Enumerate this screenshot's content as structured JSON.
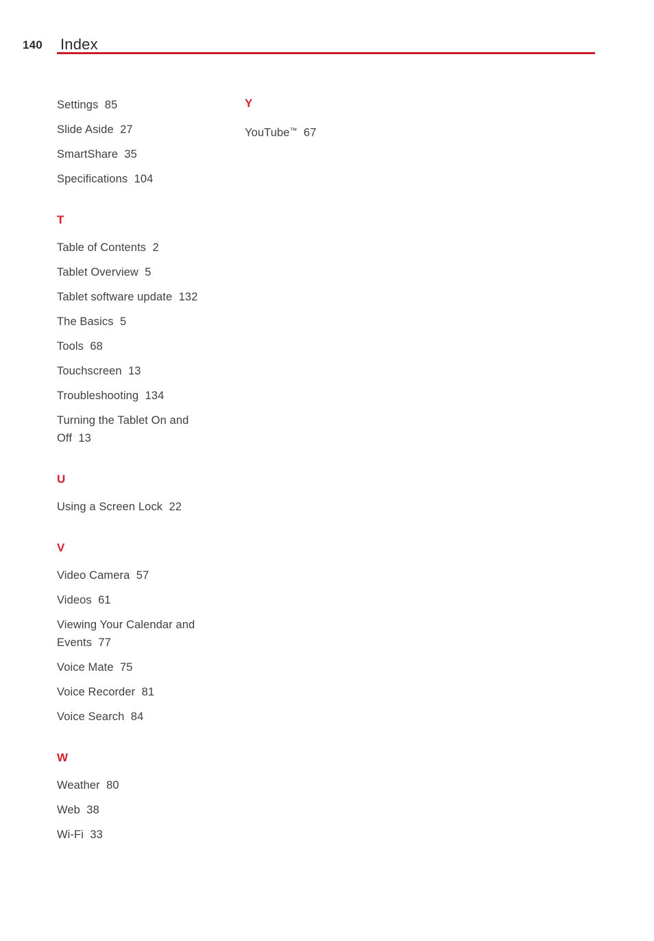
{
  "header": {
    "page_number": "140",
    "title": "Index",
    "rule_color": "#ce1b28"
  },
  "theme": {
    "accent_red": "#d41f2c",
    "text_color": "#3f3f3f"
  },
  "columns": [
    {
      "name": "left-column",
      "sections": [
        {
          "letter": "",
          "entries": [
            {
              "label": "Settings",
              "page": "85",
              "text": "Settings  85"
            },
            {
              "label": "Slide Aside",
              "page": "27",
              "text": "Slide Aside  27"
            },
            {
              "label": "SmartShare",
              "page": "35",
              "text": "SmartShare  35"
            },
            {
              "label": "Specifications",
              "page": "104",
              "text": "Specifications  104"
            }
          ]
        },
        {
          "letter": "T",
          "entries": [
            {
              "label": "Table of Contents",
              "page": "2",
              "text": "Table of Contents  2"
            },
            {
              "label": "Tablet Overview",
              "page": "5",
              "text": "Tablet Overview  5"
            },
            {
              "label": "Tablet software update",
              "page": "132",
              "text": "Tablet software update  132"
            },
            {
              "label": "The Basics",
              "page": "5",
              "text": "The Basics  5"
            },
            {
              "label": "Tools",
              "page": "68",
              "text": "Tools  68"
            },
            {
              "label": "Touchscreen",
              "page": "13",
              "text": "Touchscreen  13"
            },
            {
              "label": "Troubleshooting",
              "page": "134",
              "text": "Troubleshooting  134"
            },
            {
              "label": "Turning the Tablet On and Off",
              "page": "13",
              "text": "Turning the Tablet On and\nOff  13"
            }
          ]
        },
        {
          "letter": "U",
          "entries": [
            {
              "label": "Using a Screen Lock",
              "page": "22",
              "text": "Using a Screen Lock  22"
            }
          ]
        },
        {
          "letter": "V",
          "entries": [
            {
              "label": "Video Camera",
              "page": "57",
              "text": "Video Camera  57"
            },
            {
              "label": "Videos",
              "page": "61",
              "text": "Videos  61"
            },
            {
              "label": "Viewing Your Calendar and Events",
              "page": "77",
              "text": "Viewing Your Calendar and\nEvents  77"
            },
            {
              "label": "Voice Mate",
              "page": "75",
              "text": "Voice Mate  75"
            },
            {
              "label": "Voice Recorder",
              "page": "81",
              "text": "Voice Recorder  81"
            },
            {
              "label": "Voice Search",
              "page": "84",
              "text": "Voice Search  84"
            }
          ]
        },
        {
          "letter": "W",
          "entries": [
            {
              "label": "Weather",
              "page": "80",
              "text": "Weather  80"
            },
            {
              "label": "Web",
              "page": "38",
              "text": "Web  38"
            },
            {
              "label": "Wi-Fi",
              "page": "33",
              "text": "Wi-Fi  33"
            }
          ]
        }
      ]
    },
    {
      "name": "right-column",
      "sections": [
        {
          "letter": "Y",
          "entries": [
            {
              "label": "YouTube™",
              "page": "67",
              "text": "YouTube™  67"
            }
          ]
        }
      ]
    }
  ]
}
